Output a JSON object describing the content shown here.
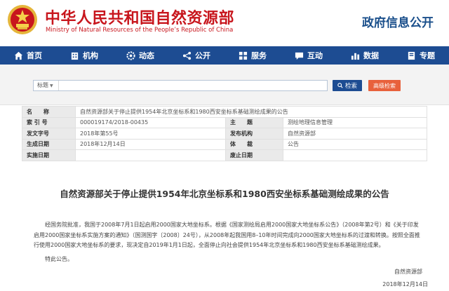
{
  "header": {
    "title_cn": "中华人民共和国自然资源部",
    "title_en": "Ministry of Natural Resources of the People’s Republic of China",
    "section_title": "政府信息公开",
    "brand_red": "#c8161d",
    "brand_blue": "#1d4c92"
  },
  "nav": {
    "items": [
      {
        "label": "首页",
        "icon": "home-icon"
      },
      {
        "label": "机构",
        "icon": "building-icon"
      },
      {
        "label": "动态",
        "icon": "gear-icon"
      },
      {
        "label": "公开",
        "icon": "share-icon"
      },
      {
        "label": "服务",
        "icon": "grid-icon"
      },
      {
        "label": "互动",
        "icon": "chat-icon"
      },
      {
        "label": "数据",
        "icon": "chart-icon"
      },
      {
        "label": "专题",
        "icon": "book-icon"
      }
    ]
  },
  "search": {
    "scope": "标题",
    "value": "",
    "button": "检索",
    "advanced": "高级检索"
  },
  "meta": {
    "name_label": "名　　称",
    "name_value": "自然资源部关于停止提供1954年北京坐标系和1980西安坐标系基础测绘成果的公告",
    "index_label": "索 引 号",
    "index_value": "000019174/2018-00435",
    "topic_label": "主　　题",
    "topic_value": "测绘地理信息管理",
    "docno_label": "发文字号",
    "docno_value": "2018年第55号",
    "issuer_label": "发布机构",
    "issuer_value": "自然资源部",
    "date_label": "生成日期",
    "date_value": "2018年12月14日",
    "type_label": "体　　裁",
    "type_value": "公告",
    "impl_label": "实施日期",
    "impl_value": "",
    "repeal_label": "废止日期",
    "repeal_value": ""
  },
  "article": {
    "title": "自然资源部关于停止提供1954年北京坐标系和1980西安坐标系基础测绘成果的公告",
    "body": "经国务院批准，我国于2008年7月1日起启用2000国家大地坐标系。根据《国家测绘局启用2000国家大地坐标系公告》（2008年第2号）和《关于印发启用2000国家坐标系实施方案的通知》（国测国字〔2008〕24号），从2008年起我国用8–10年时间完成向2000国家大地坐标系的过渡和转换。按照全面推行使用2000国家大地坐标系的要求，现决定自2019年1月1日起，全面停止向社会提供1954年北京坐标系和1980西安坐标系基础测绘成果。",
    "closing": "特此公告。",
    "signature_org": "自然资源部",
    "signature_date": "2018年12月14日"
  }
}
